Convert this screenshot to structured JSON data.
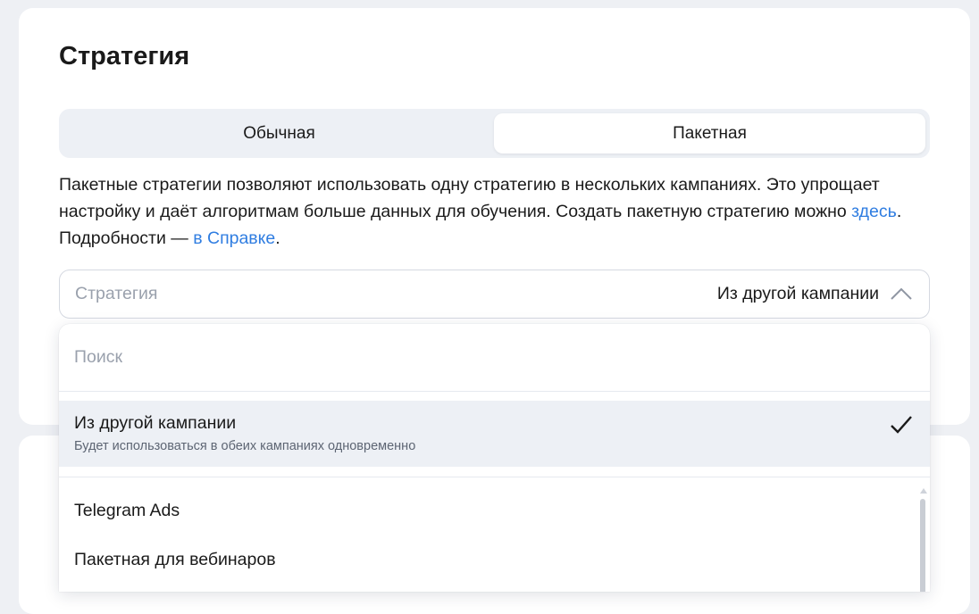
{
  "page": {
    "title": "Стратегия"
  },
  "tabs": [
    {
      "label": "Обычная",
      "active": false
    },
    {
      "label": "Пакетная",
      "active": true
    }
  ],
  "description": {
    "text1": "Пакетные стратегии позволяют использовать одну стратегию в нескольких кампаниях. Это упрощает настройку и даёт алгоритмам больше данных для обучения. Создать пакетную стратегию можно ",
    "link1": "здесь",
    "text2": ". Подробности — ",
    "link2": "в Справке",
    "text3": "."
  },
  "select": {
    "label": "Стратегия",
    "value": "Из другой кампании",
    "icon": "chevron-up-icon"
  },
  "dropdown": {
    "search_placeholder": "Поиск",
    "selected_item": {
      "title": "Из другой кампании",
      "subtitle": "Будет использоваться в обеих кампаниях одновременно",
      "icon": "checkmark-icon"
    },
    "options": [
      {
        "label": "Telegram Ads"
      },
      {
        "label": "Пакетная для вебинаров"
      }
    ]
  },
  "colors": {
    "link": "#2f7de1",
    "background": "#eef0f4",
    "selected_bg": "#edf0f5"
  }
}
